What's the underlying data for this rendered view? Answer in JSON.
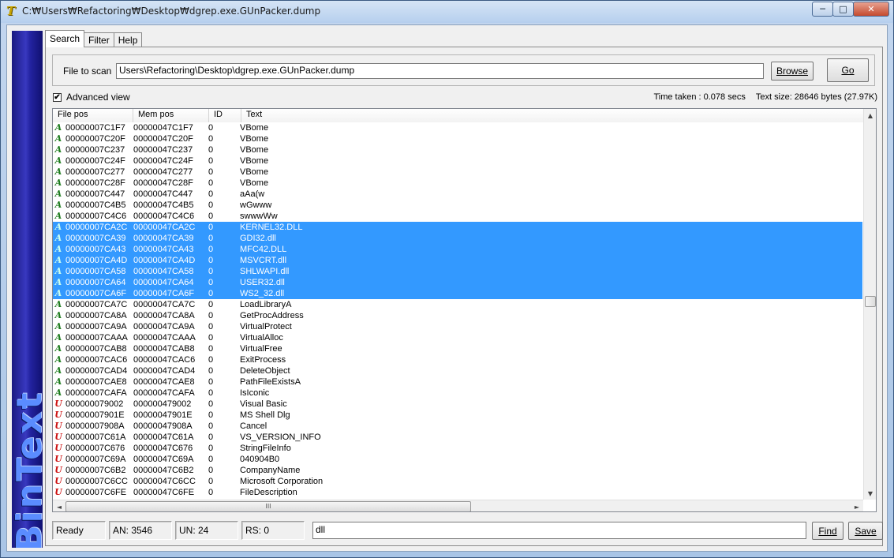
{
  "window": {
    "title": "C:₩Users₩Refactoring₩Desktop₩dgrep.exe.GUnPacker.dump",
    "app_icon": "T",
    "min_glyph": "─",
    "max_glyph": "□",
    "close_glyph": "✕"
  },
  "banner": {
    "text": "BinText"
  },
  "tabs": [
    "Search",
    "Filter",
    "Help"
  ],
  "file": {
    "label": "File to scan",
    "value": "Users\\Refactoring\\Desktop\\dgrep.exe.GUnPacker.dump",
    "browse_label": "Browse",
    "go_label": "Go"
  },
  "advanced_view": {
    "label": "Advanced view",
    "checked": true,
    "check_glyph": "✔"
  },
  "stats": {
    "time_taken": "Time taken : 0.078 secs",
    "text_size": "Text size: 28646 bytes (27.97K)"
  },
  "columns": [
    "File pos",
    "Mem pos",
    "ID",
    "Text"
  ],
  "rows": [
    {
      "type": "A",
      "file": "00000007C1F7",
      "mem": "00000047C1F7",
      "id": "0",
      "text": "VBome",
      "sel": false
    },
    {
      "type": "A",
      "file": "00000007C20F",
      "mem": "00000047C20F",
      "id": "0",
      "text": "VBome",
      "sel": false
    },
    {
      "type": "A",
      "file": "00000007C237",
      "mem": "00000047C237",
      "id": "0",
      "text": "VBome",
      "sel": false
    },
    {
      "type": "A",
      "file": "00000007C24F",
      "mem": "00000047C24F",
      "id": "0",
      "text": "VBome",
      "sel": false
    },
    {
      "type": "A",
      "file": "00000007C277",
      "mem": "00000047C277",
      "id": "0",
      "text": "VBome",
      "sel": false
    },
    {
      "type": "A",
      "file": "00000007C28F",
      "mem": "00000047C28F",
      "id": "0",
      "text": "VBome",
      "sel": false
    },
    {
      "type": "A",
      "file": "00000007C447",
      "mem": "00000047C447",
      "id": "0",
      "text": "aAa(w",
      "sel": false
    },
    {
      "type": "A",
      "file": "00000007C4B5",
      "mem": "00000047C4B5",
      "id": "0",
      "text": "wGwww",
      "sel": false
    },
    {
      "type": "A",
      "file": "00000007C4C6",
      "mem": "00000047C4C6",
      "id": "0",
      "text": "swwwWw",
      "sel": false
    },
    {
      "type": "A",
      "file": "00000007CA2C",
      "mem": "00000047CA2C",
      "id": "0",
      "text": "KERNEL32.DLL",
      "sel": true
    },
    {
      "type": "A",
      "file": "00000007CA39",
      "mem": "00000047CA39",
      "id": "0",
      "text": "GDI32.dll",
      "sel": true
    },
    {
      "type": "A",
      "file": "00000007CA43",
      "mem": "00000047CA43",
      "id": "0",
      "text": "MFC42.DLL",
      "sel": true
    },
    {
      "type": "A",
      "file": "00000007CA4D",
      "mem": "00000047CA4D",
      "id": "0",
      "text": "MSVCRT.dll",
      "sel": true
    },
    {
      "type": "A",
      "file": "00000007CA58",
      "mem": "00000047CA58",
      "id": "0",
      "text": "SHLWAPI.dll",
      "sel": true
    },
    {
      "type": "A",
      "file": "00000007CA64",
      "mem": "00000047CA64",
      "id": "0",
      "text": "USER32.dll",
      "sel": true
    },
    {
      "type": "A",
      "file": "00000007CA6F",
      "mem": "00000047CA6F",
      "id": "0",
      "text": "WS2_32.dll",
      "sel": true
    },
    {
      "type": "A",
      "file": "00000007CA7C",
      "mem": "00000047CA7C",
      "id": "0",
      "text": "LoadLibraryA",
      "sel": false
    },
    {
      "type": "A",
      "file": "00000007CA8A",
      "mem": "00000047CA8A",
      "id": "0",
      "text": "GetProcAddress",
      "sel": false
    },
    {
      "type": "A",
      "file": "00000007CA9A",
      "mem": "00000047CA9A",
      "id": "0",
      "text": "VirtualProtect",
      "sel": false
    },
    {
      "type": "A",
      "file": "00000007CAAA",
      "mem": "00000047CAAA",
      "id": "0",
      "text": "VirtualAlloc",
      "sel": false
    },
    {
      "type": "A",
      "file": "00000007CAB8",
      "mem": "00000047CAB8",
      "id": "0",
      "text": "VirtualFree",
      "sel": false
    },
    {
      "type": "A",
      "file": "00000007CAC6",
      "mem": "00000047CAC6",
      "id": "0",
      "text": "ExitProcess",
      "sel": false
    },
    {
      "type": "A",
      "file": "00000007CAD4",
      "mem": "00000047CAD4",
      "id": "0",
      "text": "DeleteObject",
      "sel": false
    },
    {
      "type": "A",
      "file": "00000007CAE8",
      "mem": "00000047CAE8",
      "id": "0",
      "text": "PathFileExistsA",
      "sel": false
    },
    {
      "type": "A",
      "file": "00000007CAFA",
      "mem": "00000047CAFA",
      "id": "0",
      "text": "IsIconic",
      "sel": false
    },
    {
      "type": "U",
      "file": "000000079002",
      "mem": "000000479002",
      "id": "0",
      "text": "Visual Basic",
      "sel": false
    },
    {
      "type": "U",
      "file": "00000007901E",
      "mem": "00000047901E",
      "id": "0",
      "text": "MS Shell Dlg",
      "sel": false
    },
    {
      "type": "U",
      "file": "00000007908A",
      "mem": "00000047908A",
      "id": "0",
      "text": "Cancel",
      "sel": false
    },
    {
      "type": "U",
      "file": "00000007C61A",
      "mem": "00000047C61A",
      "id": "0",
      "text": "VS_VERSION_INFO",
      "sel": false
    },
    {
      "type": "U",
      "file": "00000007C676",
      "mem": "00000047C676",
      "id": "0",
      "text": "StringFileInfo",
      "sel": false
    },
    {
      "type": "U",
      "file": "00000007C69A",
      "mem": "00000047C69A",
      "id": "0",
      "text": "040904B0",
      "sel": false
    },
    {
      "type": "U",
      "file": "00000007C6B2",
      "mem": "00000047C6B2",
      "id": "0",
      "text": "CompanyName",
      "sel": false
    },
    {
      "type": "U",
      "file": "00000007C6CC",
      "mem": "00000047C6CC",
      "id": "0",
      "text": "Microsoft Corporation",
      "sel": false
    },
    {
      "type": "U",
      "file": "00000007C6FE",
      "mem": "00000047C6FE",
      "id": "0",
      "text": "FileDescription",
      "sel": false
    }
  ],
  "scroll": {
    "up": "▲",
    "down": "▼",
    "left": "◄",
    "right": "►",
    "grip": "III"
  },
  "status": {
    "state": "Ready",
    "an": "AN: 3546",
    "un": "UN: 24",
    "rs": "RS: 0",
    "find_value": "dll",
    "find_label": "Find",
    "save_label": "Save"
  },
  "colors": {
    "selection": "#3399ff",
    "ansi_marker": "#1a7a1a",
    "unicode_marker": "#cc1010",
    "banner": "#2323a0"
  }
}
